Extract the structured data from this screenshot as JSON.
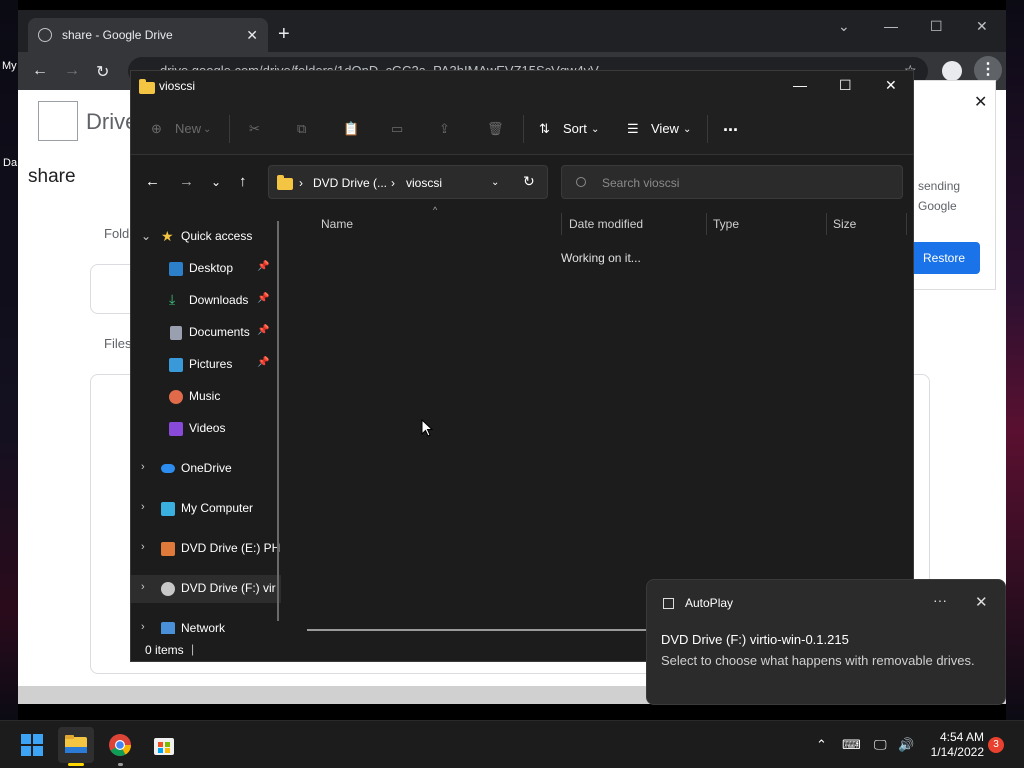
{
  "desktop": {
    "label_my": "My",
    "label_da": "Da"
  },
  "chrome": {
    "tab_title": "share - Google Drive",
    "url": "drive.google.com/drive/folders/1dOnD_cGC2a_PA3hIMAwEVZ15ScVqw4vV",
    "drive_label": "Drive",
    "page_title": "share",
    "folders_label": "Fold",
    "files_label": "Files",
    "restore_text": "sending Google",
    "restore_button": "Restore"
  },
  "explorer": {
    "title": "vioscsi",
    "commands": {
      "new": "New",
      "sort": "Sort",
      "view": "View",
      "more": "..."
    },
    "address": {
      "drive": "DVD Drive (...",
      "folder": "vioscsi"
    },
    "search_placeholder": "Search vioscsi",
    "nav": {
      "quick_access": "Quick access",
      "desktop": "Desktop",
      "downloads": "Downloads",
      "documents": "Documents",
      "pictures": "Pictures",
      "music": "Music",
      "videos": "Videos",
      "onedrive": "OneDrive",
      "my_computer": "My Computer",
      "dvd_e": "DVD Drive (E:) PH",
      "dvd_f": "DVD Drive (F:) vir",
      "network": "Network"
    },
    "columns": {
      "name": "Name",
      "date": "Date modified",
      "type": "Type",
      "size": "Size"
    },
    "working": "Working on it...",
    "status_count": "0 items"
  },
  "toast": {
    "app": "AutoPlay",
    "title": "DVD Drive (F:) virtio-win-0.1.215",
    "body": "Select to choose what happens with removable drives."
  },
  "taskbar": {
    "time": "4:54 AM",
    "date": "1/14/2022",
    "notifications": "3"
  }
}
